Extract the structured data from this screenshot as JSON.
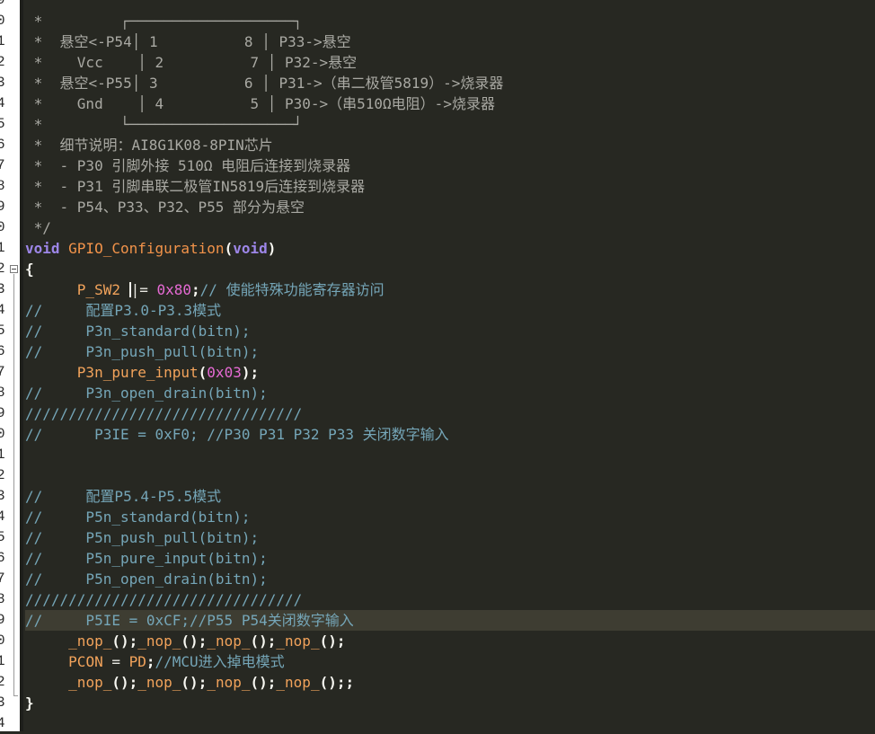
{
  "gutter": {
    "line_digits": [
      "9",
      "0",
      "1",
      "2",
      "3",
      "4",
      "5",
      "6",
      "7",
      "8",
      "9",
      "0",
      "1",
      "2",
      "3",
      "4",
      "5",
      "6",
      "7",
      "8",
      "9",
      "0",
      "1",
      "2",
      "3",
      "4",
      "5",
      "6",
      "7",
      "8",
      "9",
      "0",
      "1",
      "2",
      "3",
      "4"
    ]
  },
  "code": {
    "pin_box_top": " *         ┌───────────────────┐",
    "pin1": " *  悬空<-P54│ 1          8 │ P33->悬空",
    "pin2": " *    Vcc    │ 2          7 │ P32->悬空",
    "pin3": " *  悬空<-P55│ 3          6 │ P31->（串二极管5819）->烧录器",
    "pin4": " *    Gnd    │ 4          5 │ P30->（串510Ω电阻）->烧录器",
    "pin_box_bottom": " *         └───────────────────┘",
    "detail_title": " *  细节说明：AI8G1K08-8PIN芯片",
    "detail_1": " *  - P30 引脚外接 510Ω 电阻后连接到烧录器",
    "detail_2": " *  - P31 引脚串联二极管IN5819后连接到烧录器",
    "detail_3": " *  - P54、P33、P32、P55 部分为悬空",
    "comment_end": " */",
    "kw_void": "void",
    "func_name": " GPIO_Configuration",
    "paren_open": "(",
    "kw_void_param": "void",
    "paren_close": ")",
    "brace_open": "{",
    "indent": "      ",
    "p_sw2": "P_SW2 ",
    "or_assign": "|= ",
    "hex_80": "0x80",
    "semicolon": ";",
    "sw2_comment": "// 使能特殊功能寄存器访问",
    "cfg_p3": "//     配置P3.0-P3.3模式",
    "p3n_standard": "//     P3n_standard(bitn);",
    "p3n_push_pull": "//     P3n_push_pull(bitn);",
    "p3n_pure_input": "P3n_pure_input",
    "hex_03": "0x03",
    "close_semi": ");",
    "p3n_open_drain": "//     P3n_open_drain(bitn);",
    "slash_line_1": "////////////////////////////////",
    "p3ie_line": "//      P3IE = 0xF0; //P30 P31 P32 P33 关闭数字输入",
    "cfg_p5": "//     配置P5.4-P5.5模式",
    "p5n_standard": "//     P5n_standard(bitn);",
    "p5n_push_pull": "//     P5n_push_pull(bitn);",
    "p5n_pure_input": "//     P5n_pure_input(bitn);",
    "p5n_open_drain": "//     P5n_open_drain(bitn);",
    "slash_line_2": "////////////////////////////////",
    "p5ie_line": "//     P5IE = 0xCF;//P55 P54关闭数字输入",
    "indent2": "     ",
    "nop": "_nop_",
    "nop_call": "();",
    "pcon": "PCON ",
    "assign": "= ",
    "pd": "PD",
    "pcon_comment": "//MCU进入掉电模式",
    "semi_extra": ";",
    "brace_close": "}"
  }
}
